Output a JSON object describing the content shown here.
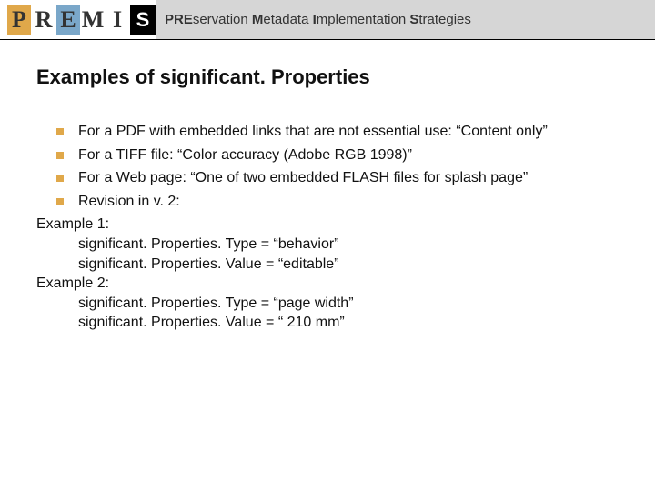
{
  "header": {
    "logo_letters": [
      "P",
      "R",
      "E",
      "M",
      "I",
      "S"
    ],
    "tagline_bold": "PRE",
    "tagline_rest1": "servation ",
    "tagline_bold2": "M",
    "tagline_rest2": "etadata ",
    "tagline_bold3": "I",
    "tagline_rest3": "mplementation ",
    "tagline_bold4": "S",
    "tagline_rest4": "trategies"
  },
  "title": "Examples of significant. Properties",
  "bullets": [
    "For a PDF with embedded links that are not essential use: “Content only”",
    "For a TIFF file: “Color accuracy (Adobe RGB 1998)”",
    "For a Web page: “One of two embedded FLASH files for splash page”",
    "Revision in v. 2:"
  ],
  "examples": {
    "ex1_label": "Example 1:",
    "ex1_line1": "significant. Properties. Type = “behavior”",
    "ex1_line2": "significant. Properties. Value = “editable”",
    "ex2_label": "Example 2:",
    "ex2_line1": "significant. Properties. Type = “page width”",
    "ex2_line2": "significant. Properties. Value = “ 210 mm”"
  }
}
